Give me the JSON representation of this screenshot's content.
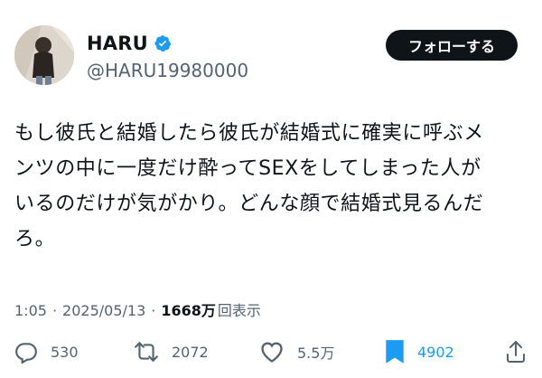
{
  "author": {
    "name": "HARU",
    "handle": "@HARU19980000",
    "verified": true,
    "avatar_icon": "profile-photo"
  },
  "follow_button": {
    "label": "フォローする"
  },
  "tweet": {
    "text": "もし彼氏と結婚したら彼氏が結婚式に確実に呼ぶメ\nンツの中に一度だけ酔ってSEXをしてしまった人が\nいるのだけが気がかり。どんな顔で結婚式見るんだ\nろ。"
  },
  "meta": {
    "time": "1:05",
    "separator": "·",
    "date": "2025/05/13",
    "views_count": "1668万",
    "views_label": "回表示"
  },
  "actions": {
    "reply": {
      "icon": "reply-icon",
      "count": "530"
    },
    "retweet": {
      "icon": "retweet-icon",
      "count": "2072"
    },
    "like": {
      "icon": "heart-icon",
      "count": "5.5万"
    },
    "bookmark": {
      "icon": "bookmark-icon",
      "count": "4902",
      "active": true,
      "color": "#1d9bf0"
    },
    "share": {
      "icon": "share-icon"
    }
  },
  "colors": {
    "text": "#0f1419",
    "secondary": "#536471",
    "accent": "#1d9bf0",
    "button_bg": "#0f1419"
  }
}
